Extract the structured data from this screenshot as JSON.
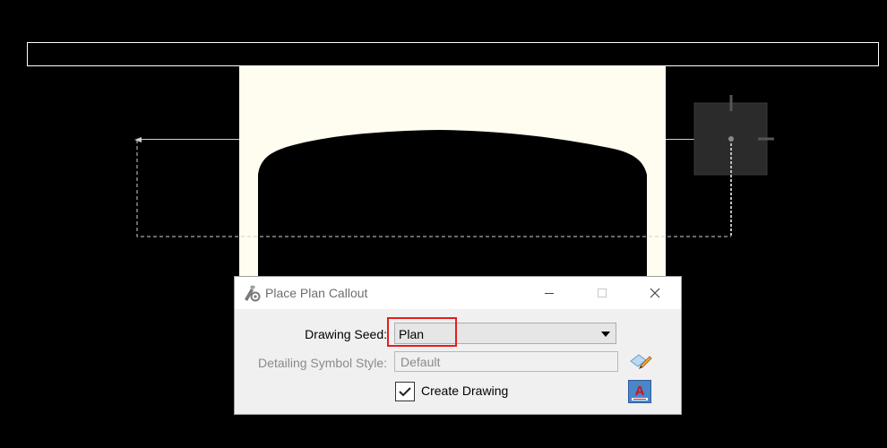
{
  "dialog": {
    "title": "Place Plan Callout",
    "seed_label": "Drawing Seed:",
    "seed_value": "Plan",
    "style_label": "Detailing Symbol Style:",
    "style_value": "Default",
    "create_drawing_label": "Create Drawing",
    "create_drawing_checked": true,
    "a_button_label": "A"
  },
  "icons": {
    "title": "tool-settings-icon",
    "minimize": "minimize-icon",
    "maximize": "maximize-icon",
    "close": "close-icon",
    "edit": "pencil-eraser-icon",
    "annotation": "text-annotation-icon"
  },
  "colors": {
    "canvas": "#000000",
    "wall_fill": "#fffdf0",
    "highlight": "#e81c1c",
    "accent_button": "#4a86c8"
  }
}
